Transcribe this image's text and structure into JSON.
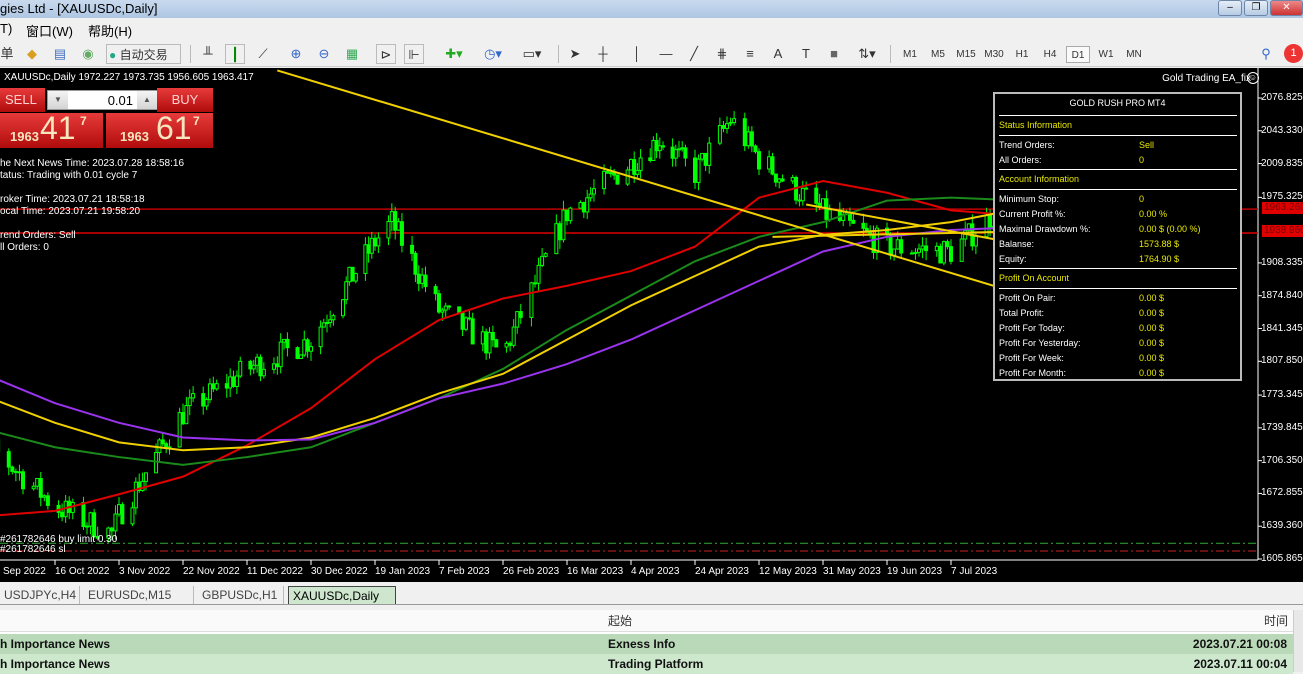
{
  "window": {
    "title": "gies Ltd - [XAUUSDc,Daily]"
  },
  "menu": [
    "T)",
    "窗口(W)",
    "帮助(H)"
  ],
  "toolbar": {
    "order_label": "单",
    "autotrade_label": "自动交易",
    "timeframes": [
      "M1",
      "M5",
      "M15",
      "M30",
      "H1",
      "H4",
      "D1",
      "W1",
      "MN"
    ],
    "active_timeframe": "D1",
    "notification_count": "1"
  },
  "chart": {
    "ohlc_header": "XAUUSDc,Daily  1972.227 1973.735 1956.605 1963.417",
    "ea_label": "Gold Trading EA_fix",
    "trade": {
      "sell": "SELL",
      "buy": "BUY",
      "lot": "0.01",
      "bid_big": "1963",
      "bid_main": "41",
      "bid_pip": "7",
      "ask_big": "1963",
      "ask_main": "61",
      "ask_pip": "7"
    },
    "left_info": [
      "he Next News Time: 2023.07.28 18:58:16",
      "tatus: Trading with 0.01 cycle 7",
      "roker Time: 2023.07.21 18:58:18",
      "ocal Time: 2023.07.21 19:58:20",
      "rend Orders: Sell",
      "ll Orders: 0"
    ],
    "order_labels": [
      "#261782646 buy limit 0.30",
      "#261782646 sl"
    ],
    "price_markers": [
      "1963.260",
      "1938.960"
    ]
  },
  "panel": {
    "title": "GOLD RUSH PRO MT4",
    "sections": [
      {
        "title": "Status Information",
        "rows": [
          [
            "Trend Orders:",
            "Sell"
          ],
          [
            "All Orders:",
            "0"
          ]
        ]
      },
      {
        "title": "Account Information",
        "rows": [
          [
            "Minimum Stop:",
            "0"
          ],
          [
            "Current Profit %:",
            "0.00 %"
          ],
          [
            "Maximal Drawdown %:",
            "0.00 $ (0.00 %)"
          ],
          [
            "Balanse:",
            "1573.88 $"
          ],
          [
            "Equity:",
            "1764.90 $"
          ]
        ]
      },
      {
        "title": "Profit On Account",
        "rows": [
          [
            "Profit On Pair:",
            "0.00 $"
          ],
          [
            "Total Profit:",
            "0.00 $"
          ],
          [
            "Profit For Today:",
            "0.00 $"
          ],
          [
            "Profit For Yesterday:",
            "0.00 $"
          ],
          [
            "Profit For Week:",
            "0.00 $"
          ],
          [
            "Profit For Month:",
            "0.00 $"
          ]
        ]
      }
    ]
  },
  "chart_data": {
    "type": "candlestick",
    "symbol": "XAUUSDc",
    "timeframe": "Daily",
    "y_ticks": [
      "2076.825",
      "2043.330",
      "2009.835",
      "1975.325",
      "1908.335",
      "1874.840",
      "1841.345",
      "1807.850",
      "1773.345",
      "1739.845",
      "1706.350",
      "1672.855",
      "1639.360",
      "1605.865"
    ],
    "ylim": [
      1605.865,
      2076.825
    ],
    "x_ticks": [
      {
        "date": "2022-09-28",
        "label": "Sep 2022"
      },
      {
        "date": "2022-10-16",
        "label": "16 Oct 2022"
      },
      {
        "date": "2022-11-03",
        "label": "3 Nov 2022"
      },
      {
        "date": "2022-11-22",
        "label": "22 Nov 2022"
      },
      {
        "date": "2022-12-11",
        "label": "11 Dec 2022"
      },
      {
        "date": "2022-12-30",
        "label": "30 Dec 2022"
      },
      {
        "date": "2023-01-19",
        "label": "19 Jan 2023"
      },
      {
        "date": "2023-02-07",
        "label": "7 Feb 2023"
      },
      {
        "date": "2023-02-26",
        "label": "26 Feb 2023"
      },
      {
        "date": "2023-03-16",
        "label": "16 Mar 2023"
      },
      {
        "date": "2023-04-04",
        "label": "4 Apr 2023"
      },
      {
        "date": "2023-04-24",
        "label": "24 Apr 2023"
      },
      {
        "date": "2023-05-12",
        "label": "12 May 2023"
      },
      {
        "date": "2023-05-31",
        "label": "31 May 2023"
      },
      {
        "date": "2023-06-19",
        "label": "19 Jun 2023"
      },
      {
        "date": "2023-07-07",
        "label": "7 Jul 2023"
      }
    ],
    "close_path": [
      [
        "2022-09-28",
        1720
      ],
      [
        "2022-10-16",
        1660
      ],
      [
        "2022-11-01",
        1632
      ],
      [
        "2022-11-03",
        1650
      ],
      [
        "2022-11-22",
        1755
      ],
      [
        "2022-12-11",
        1800
      ],
      [
        "2022-12-30",
        1830
      ],
      [
        "2023-01-19",
        1930
      ],
      [
        "2023-01-24",
        1950
      ],
      [
        "2023-02-07",
        1860
      ],
      [
        "2023-02-26",
        1815
      ],
      [
        "2023-03-16",
        1960
      ],
      [
        "2023-04-04",
        2010
      ],
      [
        "2023-04-13",
        2035
      ],
      [
        "2023-04-24",
        2000
      ],
      [
        "2023-05-04",
        2055
      ],
      [
        "2023-05-12",
        2015
      ],
      [
        "2023-05-31",
        1960
      ],
      [
        "2023-06-19",
        1925
      ],
      [
        "2023-07-07",
        1920
      ],
      [
        "2023-07-21",
        1963.417
      ]
    ],
    "ma_dates": [
      "2022-09-28",
      "2022-10-16",
      "2022-11-03",
      "2022-11-22",
      "2022-12-11",
      "2022-12-30",
      "2023-01-19",
      "2023-02-07",
      "2023-02-26",
      "2023-03-16",
      "2023-04-04",
      "2023-04-24",
      "2023-05-12",
      "2023-05-31",
      "2023-06-19",
      "2023-07-07",
      "2023-07-21"
    ],
    "moving_averages": [
      {
        "color": "#e00000",
        "values": [
          1650,
          1655,
          1672,
          1690,
          1722,
          1760,
          1810,
          1850,
          1872,
          1885,
          1900,
          1925,
          1975,
          1992,
          1980,
          1962,
          1958
        ]
      },
      {
        "color": "#1a8a1a",
        "values": [
          1737,
          1720,
          1710,
          1702,
          1710,
          1720,
          1745,
          1770,
          1800,
          1840,
          1875,
          1910,
          1935,
          1950,
          1972,
          1975,
          1973
        ]
      },
      {
        "color": "#f0d000",
        "values": [
          1770,
          1745,
          1725,
          1717,
          1720,
          1730,
          1750,
          1775,
          1795,
          1830,
          1865,
          1895,
          1925,
          1937,
          1942,
          1950,
          1960
        ]
      },
      {
        "color": "#9933ee",
        "values": [
          1792,
          1765,
          1745,
          1730,
          1727,
          1728,
          1745,
          1770,
          1785,
          1805,
          1830,
          1860,
          1890,
          1920,
          1935,
          1942,
          1944
        ]
      }
    ],
    "trendlines": [
      {
        "color": "#f0d000",
        "from": [
          "2022-12-20",
          2105
        ],
        "to": [
          "2023-08-20",
          1850
        ]
      },
      {
        "color": "#f0d000",
        "from": [
          "2023-05-26",
          1968
        ],
        "to": [
          "2023-07-20",
          1932
        ]
      },
      {
        "color": "#f0d000",
        "from": [
          "2023-05-16",
          1935
        ],
        "to": [
          "2023-07-21",
          1940
        ]
      }
    ],
    "horizontal_lines": [
      {
        "price": 1963.26,
        "color": "#c00000"
      },
      {
        "price": 1938.96,
        "color": "#e00000"
      },
      {
        "price": 1622,
        "color": "#33aa33",
        "style": "dashdot"
      },
      {
        "price": 1614,
        "color": "#cc2222",
        "style": "dashdot"
      }
    ],
    "candle_color": "#00ff00"
  },
  "tabs": [
    "USDJPYc,H4",
    "EURUSDc,M15",
    "GBPUSDc,H1",
    "XAUUSDc,Daily"
  ],
  "active_tab": "XAUUSDc,Daily",
  "news_table": {
    "headers": [
      "起始",
      "时间"
    ],
    "rows": [
      [
        "h Importance News",
        "Exness Info",
        "2023.07.21 00:08"
      ],
      [
        "h Importance News",
        "Trading Platform",
        "2023.07.11 00:04"
      ]
    ]
  }
}
